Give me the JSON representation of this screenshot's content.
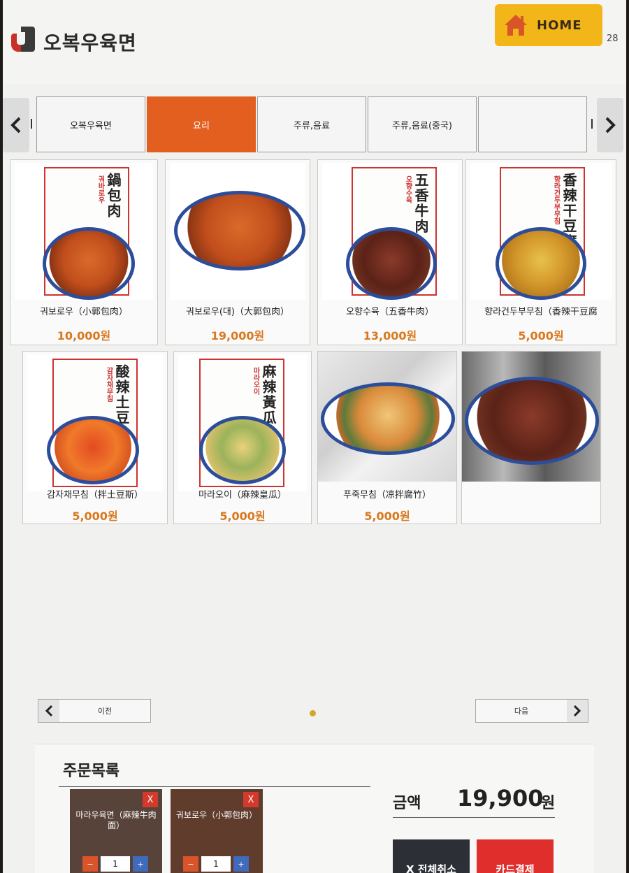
{
  "header": {
    "brand": "오복우육면",
    "home_label": "HOME",
    "counter": "28"
  },
  "categories": {
    "prev_icon": "chevron-left-icon",
    "next_icon": "chevron-right-icon",
    "tabs": [
      {
        "label": "오복우육면",
        "active": false
      },
      {
        "label": "요리",
        "active": true
      },
      {
        "label": "주류,음료",
        "active": false
      },
      {
        "label": "주류,음료(중국)",
        "active": false
      },
      {
        "label": "",
        "active": false
      }
    ]
  },
  "menu": {
    "items": [
      {
        "name": "궈보로우（小郭包肉）",
        "price": "10,000원",
        "poster_cn": "鍋包肉",
        "poster_kr": "궈바로우"
      },
      {
        "name": "궈보로우(대)（大郭包肉）",
        "price": "19,000원",
        "poster_cn": "",
        "poster_kr": ""
      },
      {
        "name": "오향수육（五香牛肉）",
        "price": "13,000원",
        "poster_cn": "五香牛肉",
        "poster_kr": "오향수육"
      },
      {
        "name": "향라건두부무침（香辣干豆腐",
        "price": "5,000원",
        "poster_cn": "香辣干豆腐絲",
        "poster_kr": "향라건두부무침"
      },
      {
        "name": "감자채무침（拌土豆斯）",
        "price": "5,000원",
        "poster_cn": "酸辣土豆絲",
        "poster_kr": "감자채무침"
      },
      {
        "name": "마라오이（麻辣皇瓜）",
        "price": "5,000원",
        "poster_cn": "麻辣黃瓜",
        "poster_kr": "마라오이"
      },
      {
        "name": "푸죽무침（凉拌腐竹）",
        "price": "5,000원",
        "poster_cn": "",
        "poster_kr": ""
      },
      {
        "name": "",
        "price": "",
        "poster_cn": "",
        "poster_kr": ""
      }
    ]
  },
  "pagination": {
    "prev_label": "이전",
    "next_label": "다음"
  },
  "order": {
    "title": "주문목록",
    "items": [
      {
        "name": "마라우육면（麻辣牛肉面）",
        "qty": "1",
        "minus": "−",
        "plus": "+",
        "remove": "X"
      },
      {
        "name": "궈보로우（小郭包肉）",
        "qty": "1",
        "minus": "−",
        "plus": "+",
        "remove": "X"
      }
    ],
    "total_label": "금액",
    "total_value": "19,900",
    "total_unit": "원",
    "cancel_label": "X 전체취소",
    "pay_label": "카드결제"
  },
  "colors": {
    "accent": "#e25f1f",
    "home": "#f2b619",
    "price": "#d9781d",
    "pay": "#e02e2c"
  }
}
